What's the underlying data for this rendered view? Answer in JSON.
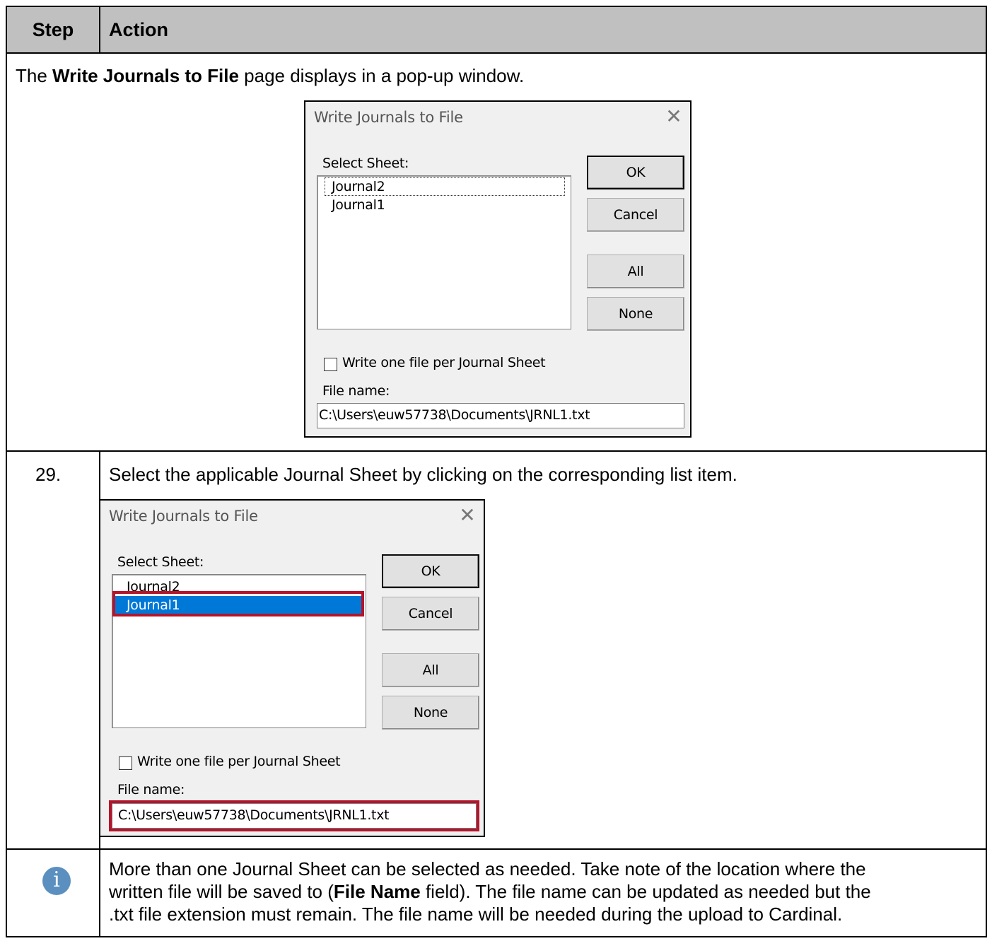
{
  "table": {
    "headers": {
      "step": "Step",
      "action": "Action"
    }
  },
  "intro": {
    "text_before": "The ",
    "text_bold": "Write Journals to File",
    "text_after": " page displays in a pop-up window."
  },
  "dialog1": {
    "title": "Write Journals to File",
    "close_glyph": "✕",
    "select_label": "Select Sheet:",
    "items": [
      "Journal2",
      "Journal1"
    ],
    "buttons": {
      "ok": "OK",
      "cancel": "Cancel",
      "all": "All",
      "none": "None"
    },
    "checkbox_label": "Write one file per Journal Sheet",
    "checkbox_checked": false,
    "file_label": "File name:",
    "file_value": "C:\\Users\\euw57738\\Documents\\JRNL1.txt"
  },
  "step29": {
    "number": "29.",
    "text": "Select the applicable Journal Sheet by clicking on the corresponding list item."
  },
  "dialog2": {
    "title": "Write Journals to File",
    "close_glyph": "✕",
    "select_label": "Select Sheet:",
    "items": [
      "Journal2",
      "Journal1"
    ],
    "selected_item": "Journal1",
    "buttons": {
      "ok": "OK",
      "cancel": "Cancel",
      "all": "All",
      "none": "None"
    },
    "checkbox_label": "Write one file per Journal Sheet",
    "checkbox_checked": false,
    "file_label": "File name:",
    "file_value": "C:\\Users\\euw57738\\Documents\\JRNL1.txt",
    "highlight_color": "#b5142b",
    "selection_color": "#0078d7"
  },
  "note": {
    "icon": "info-icon",
    "icon_glyph": "i",
    "line1": "More than one Journal Sheet can be selected as needed. Take note of the location where the",
    "line2_before": "written file will be saved to (",
    "line2_bold": "File Name",
    "line2_after": " field). The file name can be updated as needed but the",
    "line3": ".txt file extension must remain. The file name will be needed during the upload to Cardinal."
  }
}
